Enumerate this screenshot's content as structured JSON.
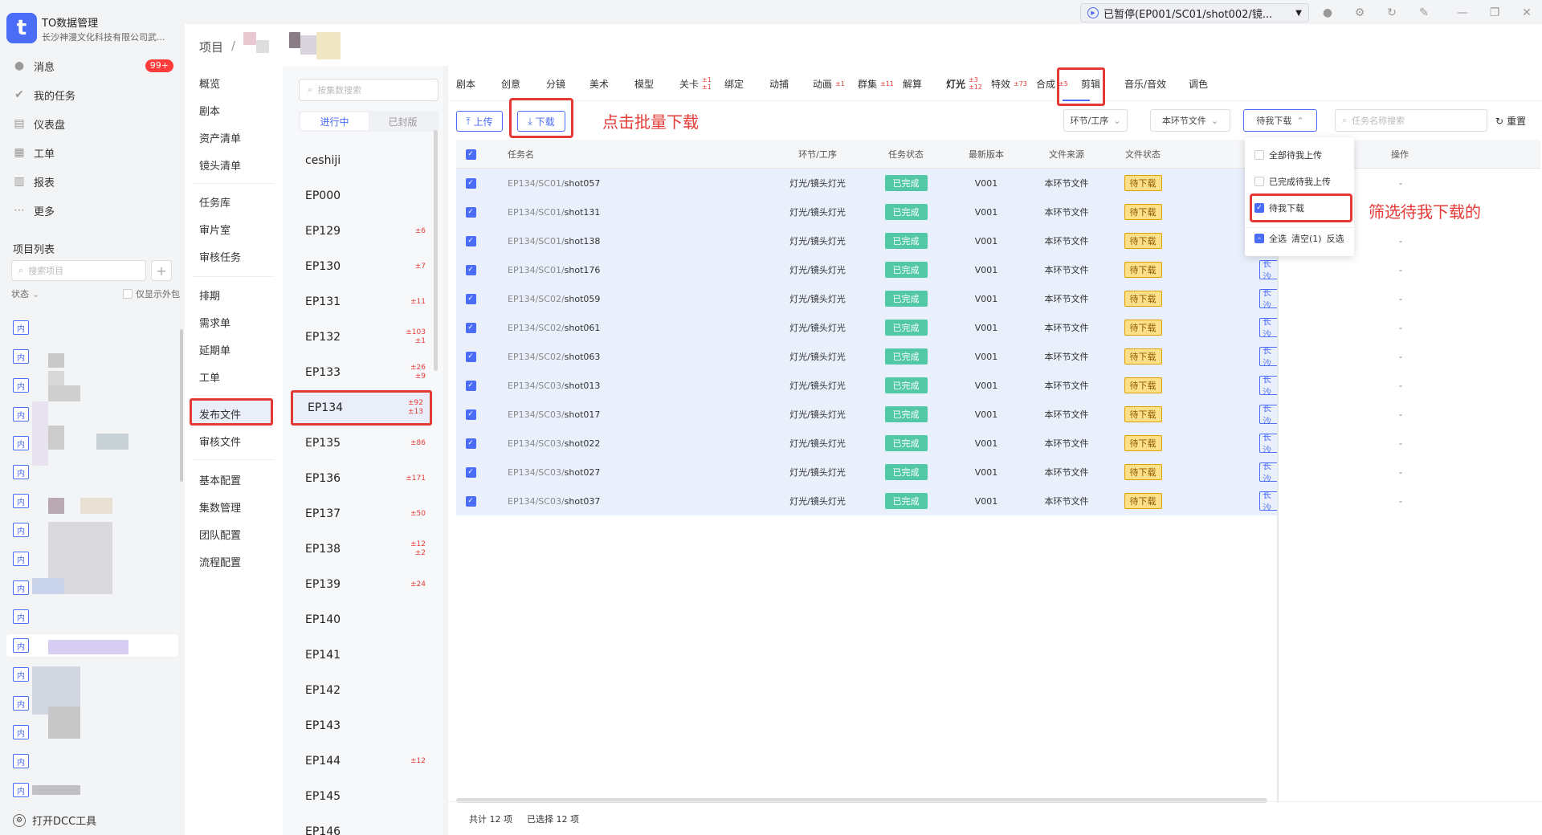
{
  "app": {
    "title": "TO数据管理",
    "subtitle": "长沙神漫文化科技有限公司武...",
    "logo_letter": "t"
  },
  "nav": [
    {
      "label": "消息",
      "icon": "message-icon",
      "badge": "99+"
    },
    {
      "label": "我的任务",
      "icon": "check-icon"
    },
    {
      "label": "仪表盘",
      "icon": "dashboard-icon"
    },
    {
      "label": "工单",
      "icon": "ticket-icon"
    },
    {
      "label": "报表",
      "icon": "report-icon"
    },
    {
      "label": "更多",
      "icon": "more-icon"
    }
  ],
  "project_list": {
    "title": "项目列表",
    "search_placeholder": "搜索项目",
    "status_label": "状态",
    "outsourced_label": "仅显示外包",
    "tag_label": "内"
  },
  "dcc_label": "打开DCC工具",
  "topbar": {
    "play_status": "已暂停(EP001/SC01/shot002/镜..."
  },
  "breadcrumb": {
    "root": "项目",
    "sep": "/"
  },
  "menu": {
    "groups": [
      [
        "概览",
        "剧本",
        "资产清单",
        "镜头清单"
      ],
      [
        "任务库",
        "审片室",
        "审核任务"
      ],
      [
        "排期",
        "需求单",
        "延期单",
        "工单"
      ],
      [
        "发布文件",
        "审核文件"
      ],
      [
        "基本配置",
        "集数管理",
        "团队配置",
        "流程配置"
      ]
    ],
    "active": "发布文件"
  },
  "episodes": {
    "search_placeholder": "按集数搜索",
    "tabs": [
      "进行中",
      "已封版"
    ],
    "items": [
      {
        "name": "ceshiji",
        "counts": []
      },
      {
        "name": "EP000",
        "counts": []
      },
      {
        "name": "EP129",
        "counts": [
          "±6"
        ]
      },
      {
        "name": "EP130",
        "counts": [
          "±7"
        ]
      },
      {
        "name": "EP131",
        "counts": [
          "±11"
        ]
      },
      {
        "name": "EP132",
        "counts": [
          "±103",
          "±1"
        ]
      },
      {
        "name": "EP133",
        "counts": [
          "±26",
          "±9"
        ]
      },
      {
        "name": "EP134",
        "counts": [
          "±92",
          "±13"
        ],
        "selected": true
      },
      {
        "name": "EP135",
        "counts": [
          "±86"
        ]
      },
      {
        "name": "EP136",
        "counts": [
          "±171"
        ]
      },
      {
        "name": "EP137",
        "counts": [
          "±50"
        ]
      },
      {
        "name": "EP138",
        "counts": [
          "±12",
          "±2"
        ]
      },
      {
        "name": "EP139",
        "counts": [
          "±24"
        ]
      },
      {
        "name": "EP140",
        "counts": []
      },
      {
        "name": "EP141",
        "counts": []
      },
      {
        "name": "EP142",
        "counts": []
      },
      {
        "name": "EP143",
        "counts": []
      },
      {
        "name": "EP144",
        "counts": [
          "±12"
        ]
      },
      {
        "name": "EP145",
        "counts": []
      },
      {
        "name": "EP146",
        "counts": []
      }
    ]
  },
  "tabs": [
    {
      "label": "剧本"
    },
    {
      "label": "创意"
    },
    {
      "label": "分镜"
    },
    {
      "label": "美术"
    },
    {
      "label": "模型"
    },
    {
      "label": "关卡",
      "sup": [
        "±1",
        "±1"
      ]
    },
    {
      "label": "绑定"
    },
    {
      "label": "动捕"
    },
    {
      "label": "动画",
      "sup": [
        "±1"
      ]
    },
    {
      "label": "群集",
      "sup": [
        "±11"
      ]
    },
    {
      "label": "解算"
    },
    {
      "label": "灯光",
      "sup": [
        "±3",
        "±12"
      ],
      "active": true
    },
    {
      "label": "特效",
      "sup": [
        "±73"
      ]
    },
    {
      "label": "合成",
      "sup": [
        "±5"
      ]
    },
    {
      "label": "剪辑"
    },
    {
      "label": "音乐/音效"
    },
    {
      "label": "调色"
    }
  ],
  "toolbar": {
    "upload": "上传",
    "download": "下载",
    "annotation_download": "点击批量下载",
    "filter_stage": "环节/工序",
    "filter_source": "本环节文件",
    "filter_status": "待我下载",
    "search_placeholder": "任务名称搜索",
    "reset": "重置"
  },
  "table": {
    "headers": [
      "任务名",
      "环节/工序",
      "任务状态",
      "最新版本",
      "文件来源",
      "文件状态",
      "操作"
    ],
    "rows": [
      {
        "prefix": "EP134/SC01/",
        "shot": "shot057",
        "stage": "灯光/镜头灯光",
        "status": "已完成",
        "version": "V001",
        "source": "本环节文件",
        "file_status": "待下载",
        "op": "-"
      },
      {
        "prefix": "EP134/SC01/",
        "shot": "shot131",
        "stage": "灯光/镜头灯光",
        "status": "已完成",
        "version": "V001",
        "source": "本环节文件",
        "file_status": "待下载",
        "op": "-"
      },
      {
        "prefix": "EP134/SC01/",
        "shot": "shot138",
        "stage": "灯光/镜头灯光",
        "status": "已完成",
        "version": "V001",
        "source": "本环节文件",
        "file_status": "待下载",
        "op": "-"
      },
      {
        "prefix": "EP134/SC01/",
        "shot": "shot176",
        "stage": "灯光/镜头灯光",
        "status": "已完成",
        "version": "V001",
        "source": "本环节文件",
        "file_status": "待下载",
        "op": "-"
      },
      {
        "prefix": "EP134/SC02/",
        "shot": "shot059",
        "stage": "灯光/镜头灯光",
        "status": "已完成",
        "version": "V001",
        "source": "本环节文件",
        "file_status": "待下载",
        "op": "-"
      },
      {
        "prefix": "EP134/SC02/",
        "shot": "shot061",
        "stage": "灯光/镜头灯光",
        "status": "已完成",
        "version": "V001",
        "source": "本环节文件",
        "file_status": "待下载",
        "op": "-"
      },
      {
        "prefix": "EP134/SC02/",
        "shot": "shot063",
        "stage": "灯光/镜头灯光",
        "status": "已完成",
        "version": "V001",
        "source": "本环节文件",
        "file_status": "待下载",
        "op": "-"
      },
      {
        "prefix": "EP134/SC03/",
        "shot": "shot013",
        "stage": "灯光/镜头灯光",
        "status": "已完成",
        "version": "V001",
        "source": "本环节文件",
        "file_status": "待下载",
        "op": "-"
      },
      {
        "prefix": "EP134/SC03/",
        "shot": "shot017",
        "stage": "灯光/镜头灯光",
        "status": "已完成",
        "version": "V001",
        "source": "本环节文件",
        "file_status": "待下载",
        "op": "-"
      },
      {
        "prefix": "EP134/SC03/",
        "shot": "shot022",
        "stage": "灯光/镜头灯光",
        "status": "已完成",
        "version": "V001",
        "source": "本环节文件",
        "file_status": "待下载",
        "op": "-"
      },
      {
        "prefix": "EP134/SC03/",
        "shot": "shot027",
        "stage": "灯光/镜头灯光",
        "status": "已完成",
        "version": "V001",
        "source": "本环节文件",
        "file_status": "待下载",
        "op": "-"
      },
      {
        "prefix": "EP134/SC03/",
        "shot": "shot037",
        "stage": "灯光/镜头灯光",
        "status": "已完成",
        "version": "V001",
        "source": "本环节文件",
        "file_status": "待下载",
        "op": "-"
      }
    ],
    "truncated_cell": "长沙"
  },
  "dropdown": {
    "options": [
      {
        "label": "全部待我上传",
        "checked": false
      },
      {
        "label": "已完成待我上传",
        "checked": false
      },
      {
        "label": "待我下载",
        "checked": true
      }
    ],
    "select_all": "全选",
    "clear": "清空(1)",
    "invert": "反选",
    "annotation": "筛选待我下载的"
  },
  "footer": {
    "total": "共计 12 项",
    "selected": "已选择 12 项"
  },
  "colors": {
    "accent": "#4a6cf7",
    "highlight": "#e53935",
    "done": "#52c9a4",
    "pending": "#ffe08a"
  }
}
